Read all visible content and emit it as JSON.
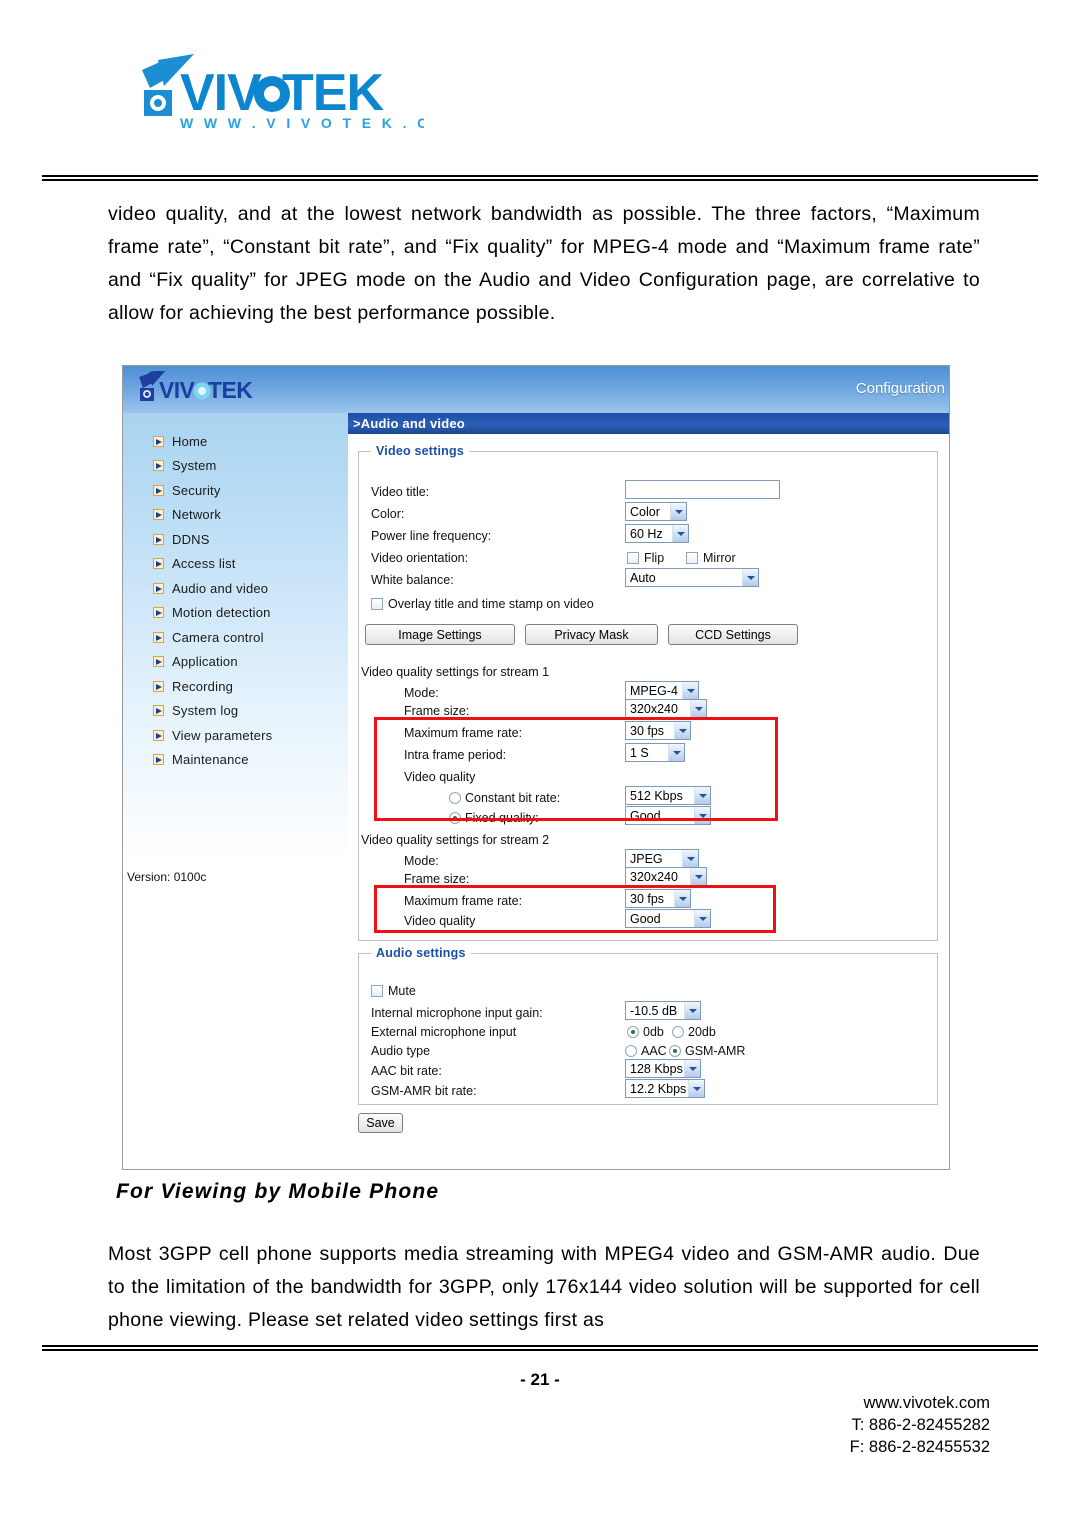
{
  "document": {
    "brand_name": "VIVOTEK",
    "brand_url": "www.vivotek.com",
    "paragraph_top": "video quality, and at the lowest network bandwidth as possible. The three factors, “Maximum frame rate”, “Constant bit rate”, and “Fix quality” for MPEG-4 mode and “Maximum frame rate” and “Fix quality” for JPEG mode on the Audio and Video Configuration page, are correlative to allow for achieving the best performance possible.",
    "section_heading": "For Viewing by Mobile Phone",
    "paragraph_bottom": "Most 3GPP cell phone supports media streaming with MPEG4 video and GSM-AMR audio. Due to the limitation of the bandwidth for 3GPP, only 176x144 video solution will be supported for cell phone viewing. Please set related video settings first as",
    "page_number": "- 21 -",
    "footer": {
      "website": "www.vivotek.com",
      "tel": "T: 886-2-82455282",
      "fax": "F: 886-2-82455532"
    }
  },
  "screenshot": {
    "header": {
      "logo_text": "VIVOTEK",
      "configuration_label": "Configuration"
    },
    "breadcrumb": ">Audio and video",
    "sidebar": {
      "items": [
        {
          "label": "Home"
        },
        {
          "label": "System"
        },
        {
          "label": "Security"
        },
        {
          "label": "Network"
        },
        {
          "label": "DDNS"
        },
        {
          "label": "Access list"
        },
        {
          "label": "Audio and video"
        },
        {
          "label": "Motion detection"
        },
        {
          "label": "Camera control"
        },
        {
          "label": "Application"
        },
        {
          "label": "Recording"
        },
        {
          "label": "System log"
        },
        {
          "label": "View parameters"
        },
        {
          "label": "Maintenance"
        }
      ],
      "version": "Version: 0100c"
    },
    "video_settings": {
      "legend": "Video settings",
      "video_title_label": "Video title:",
      "video_title_value": "",
      "color_label": "Color:",
      "color_value": "Color",
      "power_line_label": "Power line frequency:",
      "power_line_value": "60 Hz",
      "orientation_label": "Video orientation:",
      "flip_label": "Flip",
      "mirror_label": "Mirror",
      "white_balance_label": "White balance:",
      "white_balance_value": "Auto",
      "overlay_label": "Overlay title and time stamp on video",
      "buttons": {
        "image_settings": "Image Settings",
        "privacy_mask": "Privacy Mask",
        "ccd_settings": "CCD Settings"
      },
      "stream1": {
        "title": "Video quality settings for stream 1",
        "mode_label": "Mode:",
        "mode_value": "MPEG-4",
        "frame_size_label": "Frame size:",
        "frame_size_value": "320x240",
        "max_frame_rate_label": "Maximum frame rate:",
        "max_frame_rate_value": "30 fps",
        "intra_frame_label": "Intra frame period:",
        "intra_frame_value": "1 S",
        "video_quality_label": "Video quality",
        "constant_bit_rate_label": "Constant bit rate:",
        "constant_bit_rate_value": "512 Kbps",
        "fixed_quality_label": "Fixed quality:",
        "fixed_quality_value": "Good"
      },
      "stream2": {
        "title": "Video quality settings for stream 2",
        "mode_label": "Mode:",
        "mode_value": "JPEG",
        "frame_size_label": "Frame size:",
        "frame_size_value": "320x240",
        "max_frame_rate_label": "Maximum frame rate:",
        "max_frame_rate_value": "30 fps",
        "video_quality_label": "Video quality",
        "video_quality_value": "Good"
      }
    },
    "audio_settings": {
      "legend": "Audio settings",
      "mute_label": "Mute",
      "internal_mic_label": "Internal microphone input gain:",
      "internal_mic_value": "-10.5 dB",
      "external_mic_label": "External microphone input",
      "external_0db_label": "0db",
      "external_20db_label": "20db",
      "audio_type_label": "Audio type",
      "audio_type_aac_label": "AAC",
      "audio_type_gsm_label": "GSM-AMR",
      "aac_bit_rate_label": "AAC bit rate:",
      "aac_bit_rate_value": "128 Kbps",
      "gsm_bit_rate_label": "GSM-AMR bit rate:",
      "gsm_bit_rate_value": "12.2 Kbps"
    },
    "save_button": "Save",
    "accent_colors": {
      "header_blue": "#6ba4de",
      "breadcrumb_blue": "#2a5fb8",
      "legend_blue": "#1b4fa8",
      "annotation_red": "#ee1111",
      "sidebar_icon_orange": "#d9a445"
    }
  }
}
